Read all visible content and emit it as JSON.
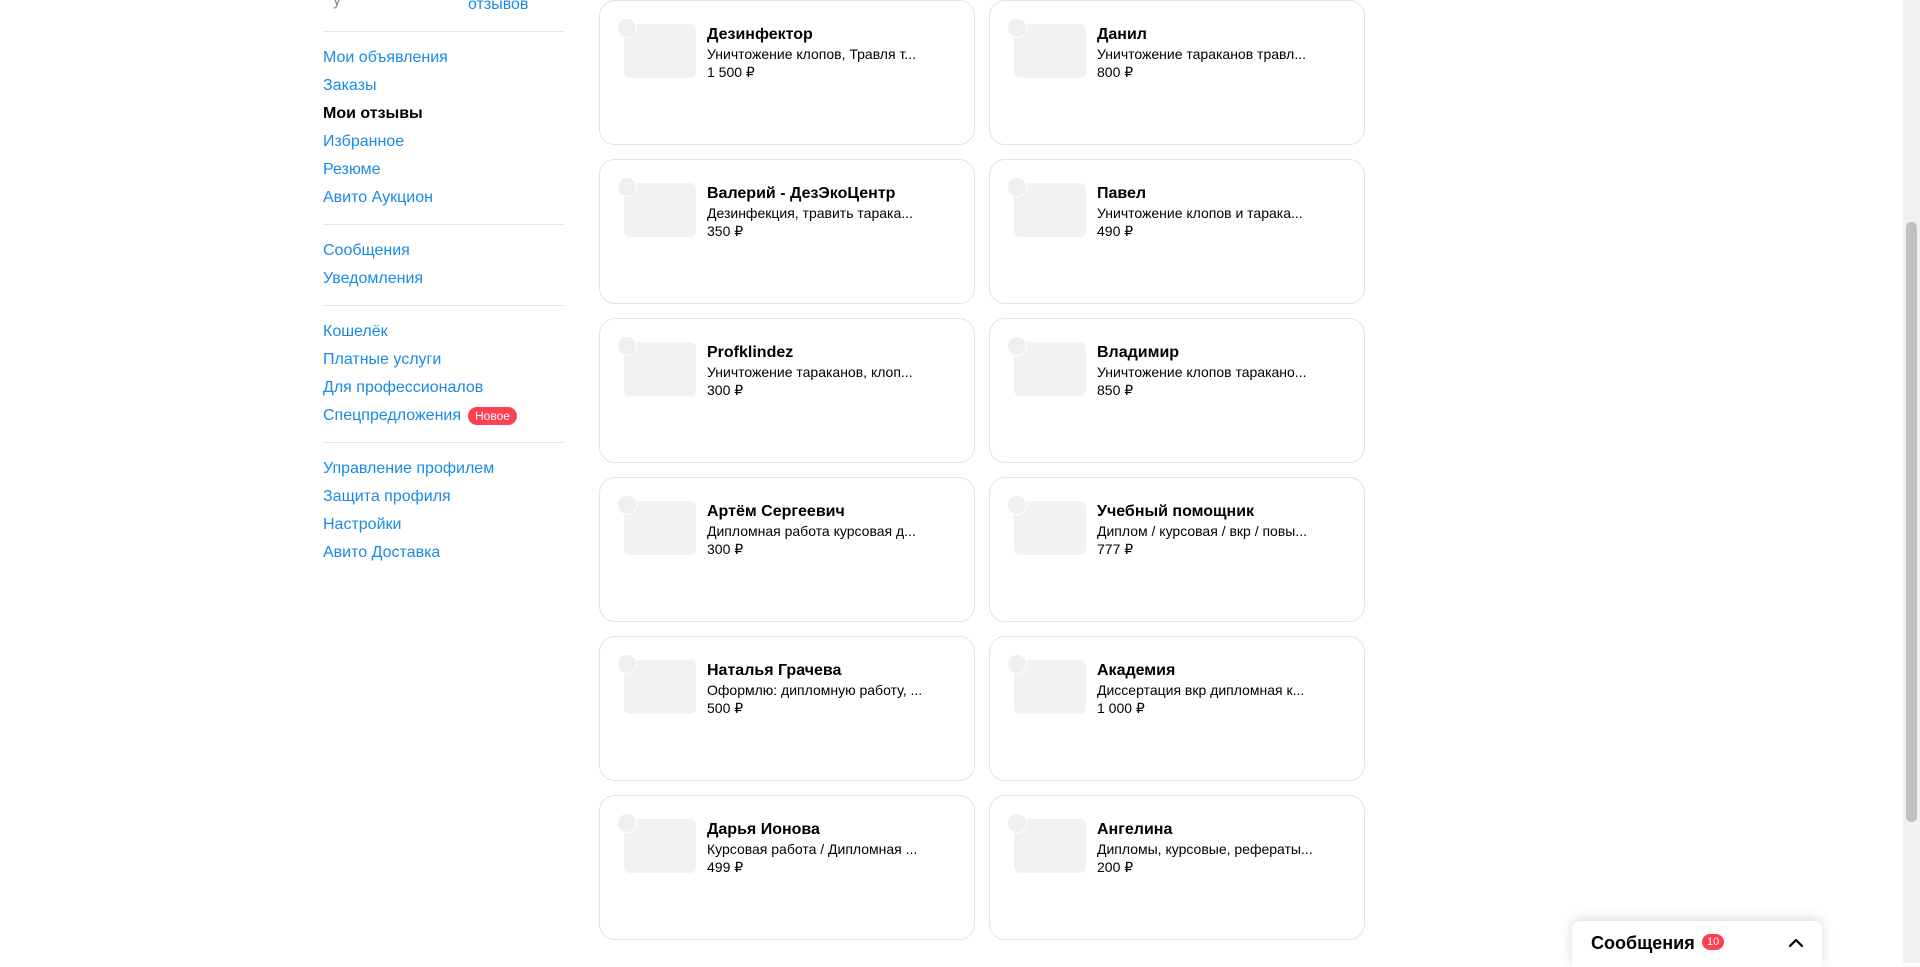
{
  "sidebar": {
    "top_cut_text": "у",
    "reviews_link": "отзывов",
    "groups": [
      {
        "items": [
          {
            "label": "Мои объявления"
          },
          {
            "label": "Заказы"
          },
          {
            "label": "Мои отзывы"
          },
          {
            "label": "Избранное"
          },
          {
            "label": "Резюме"
          },
          {
            "label": "Авито Аукцион"
          }
        ]
      },
      {
        "items": [
          {
            "label": "Сообщения"
          },
          {
            "label": "Уведомления"
          }
        ]
      },
      {
        "items": [
          {
            "label": "Кошелёк"
          },
          {
            "label": "Платные услуги"
          },
          {
            "label": "Для профессионалов"
          },
          {
            "label": "Спецпредложения",
            "badge": "Новое"
          }
        ]
      },
      {
        "items": [
          {
            "label": "Управление профилем"
          },
          {
            "label": "Защита профиля"
          },
          {
            "label": "Настройки"
          },
          {
            "label": "Авито Доставка"
          }
        ]
      }
    ]
  },
  "cards": [
    {
      "name": "Дезинфектор",
      "desc": "Уничтожение клопов, Травля т...",
      "price": "1 500 ₽"
    },
    {
      "name": "Данил",
      "desc": "Уничтожение тараканов травл...",
      "price": "800 ₽"
    },
    {
      "name": "Валерий - ДезЭкоЦентр",
      "desc": "Дезинфекция, травить тарака...",
      "price": "350 ₽"
    },
    {
      "name": "Павел",
      "desc": "Уничтожение клопов и тарака...",
      "price": "490 ₽"
    },
    {
      "name": "Profklindez",
      "desc": "Уничтожение тараканов, клоп...",
      "price": "300 ₽"
    },
    {
      "name": "Владимир",
      "desc": "Уничтожение клопов таракано...",
      "price": "850 ₽"
    },
    {
      "name": "Артём Сергеевич",
      "desc": "Дипломная работа курсовая д...",
      "price": "300 ₽"
    },
    {
      "name": "Учебный помощник",
      "desc": "Диплом / курсовая / вкр / повы...",
      "price": "777 ₽"
    },
    {
      "name": "Наталья Грачева",
      "desc": "Оформлю: дипломную работу, ...",
      "price": "500 ₽"
    },
    {
      "name": "Академия",
      "desc": "Диссертация вкр дипломная к...",
      "price": "1 000 ₽"
    },
    {
      "name": "Дарья Ионова",
      "desc": "Курсовая работа / Дипломная ...",
      "price": "499 ₽"
    },
    {
      "name": "Ангелина",
      "desc": "Дипломы, курсовые, рефераты...",
      "price": "200 ₽"
    }
  ],
  "messages_widget": {
    "title": "Сообщения",
    "count": "10"
  },
  "icons": {
    "chevron": "chevron-up-icon"
  }
}
